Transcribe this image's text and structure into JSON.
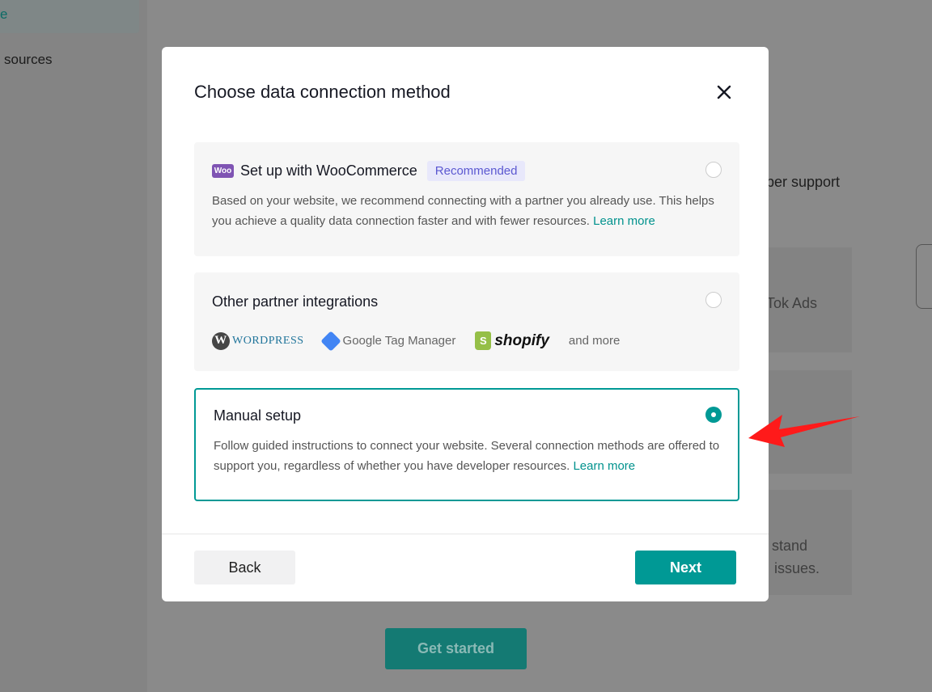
{
  "background": {
    "sidebar_selected": "e",
    "sidebar_item": "sources",
    "heading_fragment": "per support",
    "card_1_fragment": "Tok Ads",
    "card_3_fragment_1": "stand",
    "card_3_fragment_2": "issues.",
    "get_started_label": "Get started"
  },
  "modal": {
    "title": "Choose data connection method",
    "options": [
      {
        "title": "Set up with WooCommerce",
        "badge": "Recommended",
        "description": "Based on your website, we recommend connecting with a partner you already use. This helps you achieve a quality data connection faster and with fewer resources.",
        "link": "Learn more",
        "selected": false
      },
      {
        "title": "Other partner integrations",
        "partners": [
          "WordPress",
          "Google Tag Manager",
          "shopify"
        ],
        "more": "and more",
        "selected": false
      },
      {
        "title": "Manual setup",
        "description": "Follow guided instructions to connect your website. Several connection methods are offered to support you, regardless of whether you have developer resources.",
        "link": "Learn more",
        "selected": true
      }
    ],
    "back_label": "Back",
    "next_label": "Next"
  },
  "colors": {
    "accent": "#009995",
    "badge": "#5b58d1",
    "annotation_arrow": "#ff0000"
  }
}
